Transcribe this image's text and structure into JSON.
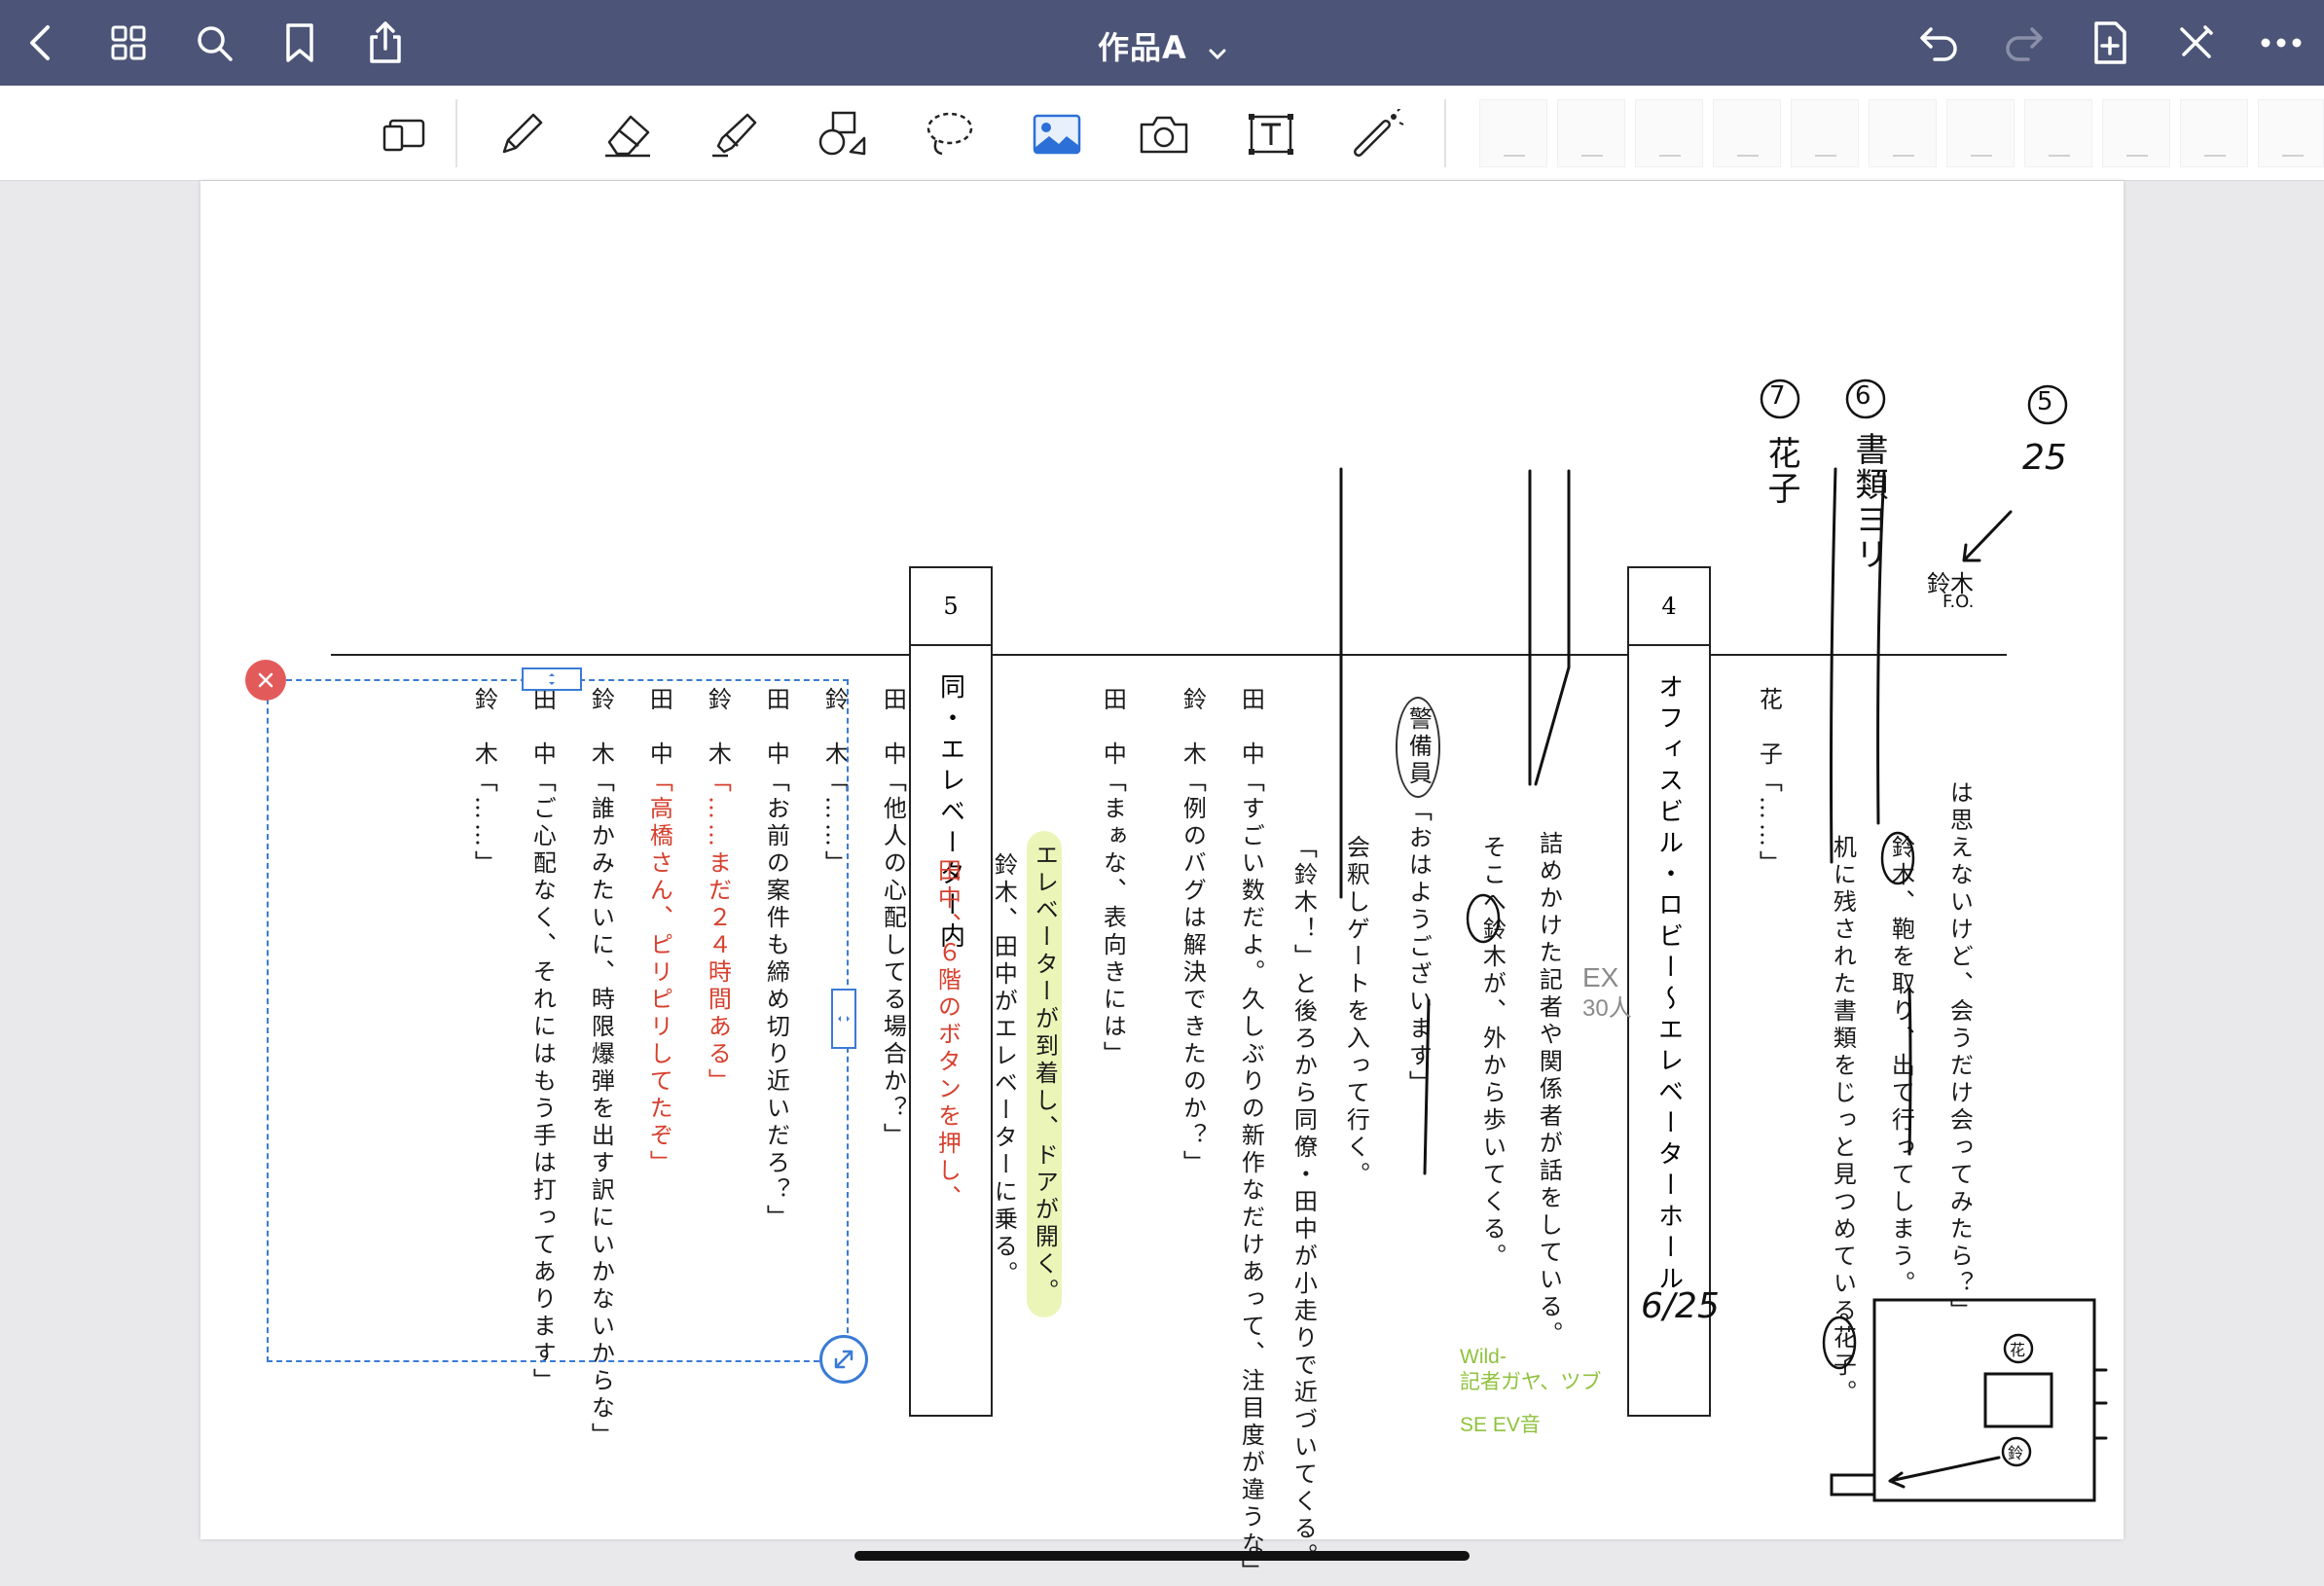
{
  "header": {
    "title": "作品A",
    "back_icon": "chevron-left-icon",
    "grid_icon": "grid-icon",
    "search_icon": "search-icon",
    "bookmark_icon": "bookmark-icon",
    "share_icon": "share-icon",
    "title_dropdown_icon": "chevron-down-icon",
    "undo_icon": "undo-icon",
    "redo_icon": "redo-icon",
    "add_page_icon": "add-page-icon",
    "exit_edit_icon": "pencil-slash-icon",
    "more_icon": "more-icon"
  },
  "toolbar": {
    "tools": [
      "page-layout",
      "pen",
      "eraser",
      "highlighter",
      "shapes",
      "lasso",
      "image",
      "camera",
      "text",
      "laser-pointer"
    ]
  },
  "script": {
    "scene5": {
      "number": "5",
      "title": "同・エレベーター内"
    },
    "scene4": {
      "number": "4",
      "title": "オフィスビル・ロビー～エレベーターホール"
    },
    "lines": {
      "s5_suzuki_end": {
        "speaker": "鈴　木",
        "text": "「……」"
      },
      "s5_tanaka_worry": {
        "speaker": "田　中",
        "text": "「ご心配なく、それにはもう手は打ってあります」"
      },
      "s5_suzuki_bomb": {
        "speaker": "鈴　木",
        "text": "「誰かみたいに、時限爆弾を出す訳にいかないからな」"
      },
      "s5_tanaka_takahashi": {
        "speaker": "田　中",
        "text": "「高橋さん、ピリピリしてたぞ」"
      },
      "s5_suzuki_24": {
        "speaker": "鈴　木",
        "text": "「……まだ２４時間ある」"
      },
      "s5_tanaka_case": {
        "speaker": "田　中",
        "text": "「お前の案件も締め切り近いだろ？」"
      },
      "s5_suzuki_dots": {
        "speaker": "鈴　木",
        "text": "「……」"
      },
      "s5_tanaka_other": {
        "speaker": "田　中",
        "text": "「他人の心配してる場合か？」"
      },
      "s5_action_button": {
        "text": "田中、６階のボタンを押し、"
      },
      "s5_action_ride": {
        "text": "鈴木、田中がエレベーターに乗る。"
      },
      "s4_action_arrive": {
        "text": "エレベーターが到着し、ドアが開く。"
      },
      "s4_tanaka_face": {
        "speaker": "田　中",
        "text": "「まぁな、表向きには」"
      },
      "s4_suzuki_bug": {
        "speaker": "鈴　木",
        "text": "「例のバグは解決できたのか？」"
      },
      "s4_tanaka_amazing": {
        "speaker": "田　中",
        "text": "「すごい数だよ。久しぶりの新作なだけあって、注目度が違うな」"
      },
      "s4_action_colleague": {
        "text": "「鈴木！」と後ろから同僚・田中が小走りで近づいてくる。"
      },
      "s4_action_gate": {
        "text": "会釈しゲートを入って行く。"
      },
      "s4_guard": {
        "speaker": "警備員",
        "text": "「おはようございます」"
      },
      "s4_action_suzuki_walk": {
        "text": "そこへ鈴木が、外から歩いてくる。"
      },
      "s4_action_reporters": {
        "text": "詰めかけた記者や関係者が話をしている。"
      },
      "prev_hanako_speaker": {
        "speaker": "花　子",
        "text": "「……」"
      },
      "prev_hanako_desk": {
        "text": "机に残された書類をじっと見つめている花子。"
      },
      "prev_suzuki_leave": {
        "text": "鈴木、鞄を取り、出て行ってしまう。"
      },
      "prev_dialogue": {
        "text": "は思えないけど、会うだけ会ってみたら？」"
      }
    }
  },
  "annotations": {
    "handwritten": {
      "num7": "7",
      "num6": "6",
      "num5": "5",
      "hanako": "花子",
      "shorui": "書類ヨリ",
      "twenty_five": "25",
      "suzuki_fo": "鈴木",
      "fo_label": "F.O.",
      "date": "6/25",
      "ex": "EX",
      "ex_count": "30人",
      "map_hana": "花",
      "map_suzu": "鈴"
    },
    "green_notes": [
      "Wild-",
      "記者ガヤ、ツブ",
      "SE EV音"
    ]
  },
  "colors": {
    "header_bg": "#4c5577",
    "red_text": "#d7402e",
    "highlight": "#ecf5b8",
    "selection": "#3a7bd5",
    "delete_button": "#e35a5a",
    "green_note": "#8fc23d"
  }
}
